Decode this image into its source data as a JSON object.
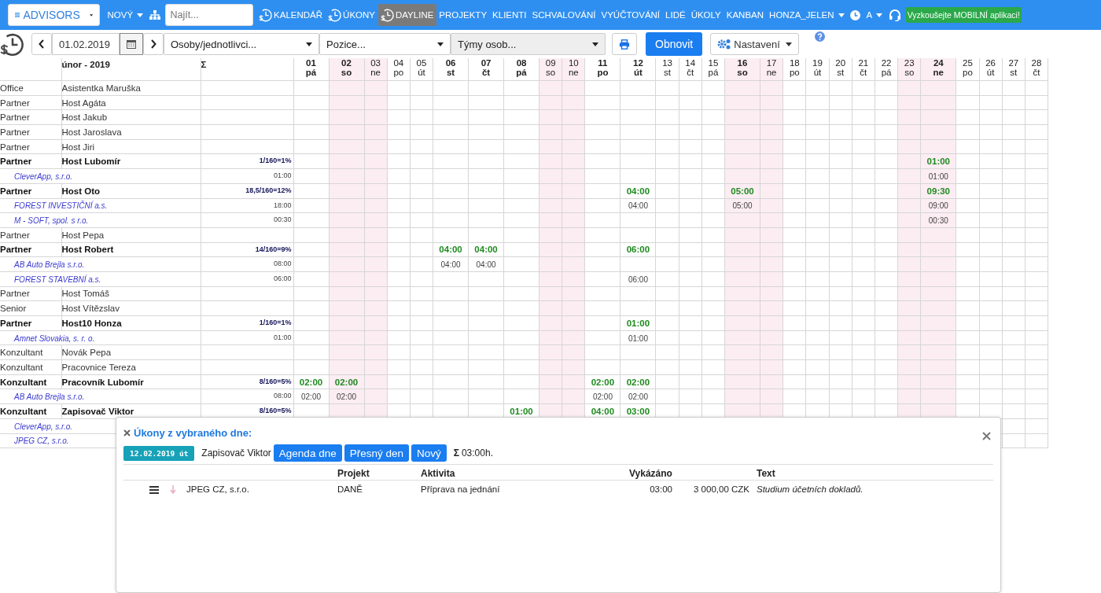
{
  "navbar": {
    "items": [
      {
        "kind": "brand",
        "label": "ADVISORS"
      },
      {
        "kind": "dropdown",
        "label": "NOVÝ"
      },
      {
        "kind": "sitemap"
      },
      {
        "kind": "search",
        "placeholder": "Najít..."
      },
      {
        "kind": "icon-link",
        "label": "KALENDÁŘ",
        "selected": false
      },
      {
        "kind": "icon-link",
        "label": "ÚKONY",
        "selected": false
      },
      {
        "kind": "icon-link",
        "label": "DAYLINE",
        "selected": true
      },
      {
        "kind": "link",
        "label": "PROJEKTY",
        "selected": false
      },
      {
        "kind": "link",
        "label": "KLIENTI",
        "selected": false
      },
      {
        "kind": "link",
        "label": "SCHVALOVÁNÍ",
        "selected": false
      },
      {
        "kind": "link",
        "label": "VYÚČTOVÁNÍ",
        "selected": false
      },
      {
        "kind": "link",
        "label": "LIDÉ",
        "selected": false
      },
      {
        "kind": "link",
        "label": "ÚKOLY",
        "selected": false
      },
      {
        "kind": "link",
        "label": "KANBAN",
        "selected": false
      },
      {
        "kind": "dropdown",
        "label": "HONZA_JELEN"
      },
      {
        "kind": "clock"
      },
      {
        "kind": "dropdown",
        "label": "A"
      },
      {
        "kind": "support"
      },
      {
        "kind": "promo",
        "label": "Vyzkoušejte MOBILNÍ aplikaci!"
      }
    ]
  },
  "toolbar": {
    "date": "01.02.2019",
    "selects": [
      {
        "value": "Osoby/jednotlivci...",
        "disabled": false
      },
      {
        "value": "Pozice...",
        "disabled": false
      },
      {
        "value": "Týmy osob...",
        "disabled": true
      }
    ],
    "buttons": [
      {
        "kind": "print"
      },
      {
        "kind": "primary",
        "label": "Obnovit"
      },
      {
        "kind": "settings",
        "label": "Nastavení"
      },
      {
        "kind": "help"
      }
    ]
  },
  "table": {
    "month": "únor - 2019",
    "sum": "Σ",
    "days": [
      {
        "num": "01",
        "dow": "pá",
        "weekend": false,
        "highlight": true
      },
      {
        "num": "02",
        "dow": "so",
        "weekend": true,
        "highlight": true
      },
      {
        "num": "03",
        "dow": "ne",
        "weekend": true,
        "highlight": false
      },
      {
        "num": "04",
        "dow": "po",
        "weekend": false,
        "highlight": false
      },
      {
        "num": "05",
        "dow": "út",
        "weekend": false,
        "highlight": false
      },
      {
        "num": "06",
        "dow": "st",
        "weekend": false,
        "highlight": true
      },
      {
        "num": "07",
        "dow": "čt",
        "weekend": false,
        "highlight": true
      },
      {
        "num": "08",
        "dow": "pá",
        "weekend": false,
        "highlight": true
      },
      {
        "num": "09",
        "dow": "so",
        "weekend": true,
        "highlight": false
      },
      {
        "num": "10",
        "dow": "ne",
        "weekend": true,
        "highlight": false
      },
      {
        "num": "11",
        "dow": "po",
        "weekend": false,
        "highlight": true
      },
      {
        "num": "12",
        "dow": "út",
        "weekend": false,
        "highlight": true
      },
      {
        "num": "13",
        "dow": "st",
        "weekend": false,
        "highlight": false
      },
      {
        "num": "14",
        "dow": "čt",
        "weekend": false,
        "highlight": false
      },
      {
        "num": "15",
        "dow": "pá",
        "weekend": false,
        "highlight": false
      },
      {
        "num": "16",
        "dow": "so",
        "weekend": true,
        "highlight": true
      },
      {
        "num": "17",
        "dow": "ne",
        "weekend": true,
        "highlight": false
      },
      {
        "num": "18",
        "dow": "po",
        "weekend": false,
        "highlight": false
      },
      {
        "num": "19",
        "dow": "út",
        "weekend": false,
        "highlight": false
      },
      {
        "num": "20",
        "dow": "st",
        "weekend": false,
        "highlight": false
      },
      {
        "num": "21",
        "dow": "čt",
        "weekend": false,
        "highlight": false
      },
      {
        "num": "22",
        "dow": "pá",
        "weekend": false,
        "highlight": false
      },
      {
        "num": "23",
        "dow": "so",
        "weekend": true,
        "highlight": false
      },
      {
        "num": "24",
        "dow": "ne",
        "weekend": true,
        "highlight": true
      },
      {
        "num": "25",
        "dow": "po",
        "weekend": false,
        "highlight": false
      },
      {
        "num": "26",
        "dow": "út",
        "weekend": false,
        "highlight": false
      },
      {
        "num": "27",
        "dow": "st",
        "weekend": false,
        "highlight": false
      },
      {
        "num": "28",
        "dow": "čt",
        "weekend": false,
        "highlight": false
      }
    ],
    "rows": [
      {
        "kind": "person",
        "position": "Office",
        "name": "Asistentka Maruška",
        "active": false
      },
      {
        "kind": "person",
        "position": "Partner",
        "name": "Host Agáta",
        "active": false
      },
      {
        "kind": "person",
        "position": "Partner",
        "name": "Host Jakub",
        "active": false
      },
      {
        "kind": "person",
        "position": "Partner",
        "name": "Host Jaroslava",
        "active": false
      },
      {
        "kind": "person",
        "position": "Partner",
        "name": "Host Jiri",
        "active": false
      },
      {
        "kind": "person",
        "position": "Partner",
        "name": "Host Lubomír",
        "active": true,
        "total": "1/160=1%",
        "cells": [
          null,
          null,
          null,
          null,
          null,
          null,
          null,
          null,
          null,
          null,
          null,
          null,
          null,
          null,
          null,
          null,
          null,
          null,
          null,
          null,
          null,
          null,
          null,
          "01:00",
          null,
          null,
          null,
          null
        ]
      },
      {
        "kind": "client",
        "name": "CleverApp, s.r.o.",
        "total": "01:00",
        "cells": [
          null,
          null,
          null,
          null,
          null,
          null,
          null,
          null,
          null,
          null,
          null,
          null,
          null,
          null,
          null,
          null,
          null,
          null,
          null,
          null,
          null,
          null,
          null,
          "01:00",
          null,
          null,
          null,
          null
        ]
      },
      {
        "kind": "person",
        "position": "Partner",
        "name": "Host Oto",
        "active": true,
        "total": "18,5/160=12%",
        "cells": [
          null,
          null,
          null,
          null,
          null,
          null,
          null,
          null,
          null,
          null,
          null,
          "04:00",
          null,
          null,
          null,
          "05:00",
          null,
          null,
          null,
          null,
          null,
          null,
          null,
          "09:30",
          null,
          null,
          null,
          null
        ]
      },
      {
        "kind": "client",
        "name": "FOREST INVESTIČNÍ a.s.",
        "total": "18:00",
        "cells": [
          null,
          null,
          null,
          null,
          null,
          null,
          null,
          null,
          null,
          null,
          null,
          "04:00",
          null,
          null,
          null,
          "05:00",
          null,
          null,
          null,
          null,
          null,
          null,
          null,
          "09:00",
          null,
          null,
          null,
          null
        ]
      },
      {
        "kind": "client",
        "name": "M - SOFT, spol. s r.o.",
        "total": "00:30",
        "cells": [
          null,
          null,
          null,
          null,
          null,
          null,
          null,
          null,
          null,
          null,
          null,
          null,
          null,
          null,
          null,
          null,
          null,
          null,
          null,
          null,
          null,
          null,
          null,
          "00:30",
          null,
          null,
          null,
          null
        ]
      },
      {
        "kind": "person",
        "position": "Partner",
        "name": "Host Pepa",
        "active": false
      },
      {
        "kind": "person",
        "position": "Partner",
        "name": "Host Robert",
        "active": true,
        "total": "14/160=9%",
        "cells": [
          null,
          null,
          null,
          null,
          null,
          "04:00",
          "04:00",
          null,
          null,
          null,
          null,
          "06:00",
          null,
          null,
          null,
          null,
          null,
          null,
          null,
          null,
          null,
          null,
          null,
          null,
          null,
          null,
          null,
          null
        ]
      },
      {
        "kind": "client",
        "name": "AB Auto Brejla s.r.o.",
        "total": "08:00",
        "cells": [
          null,
          null,
          null,
          null,
          null,
          "04:00",
          "04:00",
          null,
          null,
          null,
          null,
          null,
          null,
          null,
          null,
          null,
          null,
          null,
          null,
          null,
          null,
          null,
          null,
          null,
          null,
          null,
          null,
          null
        ]
      },
      {
        "kind": "client",
        "name": "FOREST STAVEBNÍ a.s.",
        "total": "06:00",
        "cells": [
          null,
          null,
          null,
          null,
          null,
          null,
          null,
          null,
          null,
          null,
          null,
          "06:00",
          null,
          null,
          null,
          null,
          null,
          null,
          null,
          null,
          null,
          null,
          null,
          null,
          null,
          null,
          null,
          null
        ]
      },
      {
        "kind": "person",
        "position": "Partner",
        "name": "Host Tomáš",
        "active": false
      },
      {
        "kind": "person",
        "position": "Senior",
        "name": "Host Vítězslav",
        "active": false
      },
      {
        "kind": "person",
        "position": "Partner",
        "name": "Host10 Honza",
        "active": true,
        "total": "1/160=1%",
        "cells": [
          null,
          null,
          null,
          null,
          null,
          null,
          null,
          null,
          null,
          null,
          null,
          "01:00",
          null,
          null,
          null,
          null,
          null,
          null,
          null,
          null,
          null,
          null,
          null,
          null,
          null,
          null,
          null,
          null
        ]
      },
      {
        "kind": "client",
        "name": "Amnet Slovakia, s. r. o.",
        "total": "01:00",
        "cells": [
          null,
          null,
          null,
          null,
          null,
          null,
          null,
          null,
          null,
          null,
          null,
          "01:00",
          null,
          null,
          null,
          null,
          null,
          null,
          null,
          null,
          null,
          null,
          null,
          null,
          null,
          null,
          null,
          null
        ]
      },
      {
        "kind": "person",
        "position": "Konzultant",
        "name": "Novák Pepa",
        "active": false
      },
      {
        "kind": "person",
        "position": "Konzultant",
        "name": "Pracovnice Tereza",
        "active": false
      },
      {
        "kind": "person",
        "position": "Konzultant",
        "name": "Pracovník Lubomír",
        "active": true,
        "total": "8/160=5%",
        "cells": [
          "02:00",
          "02:00",
          null,
          null,
          null,
          null,
          null,
          null,
          null,
          null,
          "02:00",
          "02:00",
          null,
          null,
          null,
          null,
          null,
          null,
          null,
          null,
          null,
          null,
          null,
          null,
          null,
          null,
          null,
          null
        ]
      },
      {
        "kind": "client",
        "name": "AB Auto Brejla s.r.o.",
        "total": "08:00",
        "cells": [
          "02:00",
          "02:00",
          null,
          null,
          null,
          null,
          null,
          null,
          null,
          null,
          "02:00",
          "02:00",
          null,
          null,
          null,
          null,
          null,
          null,
          null,
          null,
          null,
          null,
          null,
          null,
          null,
          null,
          null,
          null
        ]
      },
      {
        "kind": "person",
        "position": "Konzultant",
        "name": "Zapisovač Viktor",
        "active": true,
        "total": "8/160=5%",
        "cells": [
          null,
          null,
          null,
          null,
          null,
          null,
          null,
          "01:00",
          null,
          null,
          "04:00",
          "03:00",
          null,
          null,
          null,
          null,
          null,
          null,
          null,
          null,
          null,
          null,
          null,
          null,
          null,
          null,
          null,
          null
        ]
      },
      {
        "kind": "client",
        "name": "CleverApp, s.r.o."
      },
      {
        "kind": "client",
        "name": "JPEG CZ, s.r.o."
      }
    ]
  },
  "popup": {
    "title": "Úkony z vybraného dne:",
    "date": "12.02.2019 út",
    "person": "Zapisovač Viktor",
    "buttons": [
      "Agenda dne",
      "Přesný den",
      "Nový"
    ],
    "sum_sign": "Σ",
    "sum": "03:00h.",
    "columns": [
      null,
      "Projekt",
      "Aktivita",
      "Vykázáno",
      null,
      "Text"
    ],
    "rows": [
      {
        "cells": [
          "JPEG CZ, s.r.o.",
          "DANĚ",
          "Příprava na jednání",
          "03:00",
          "3 000,00 CZK",
          "Studium účetních dokladů."
        ]
      }
    ]
  }
}
